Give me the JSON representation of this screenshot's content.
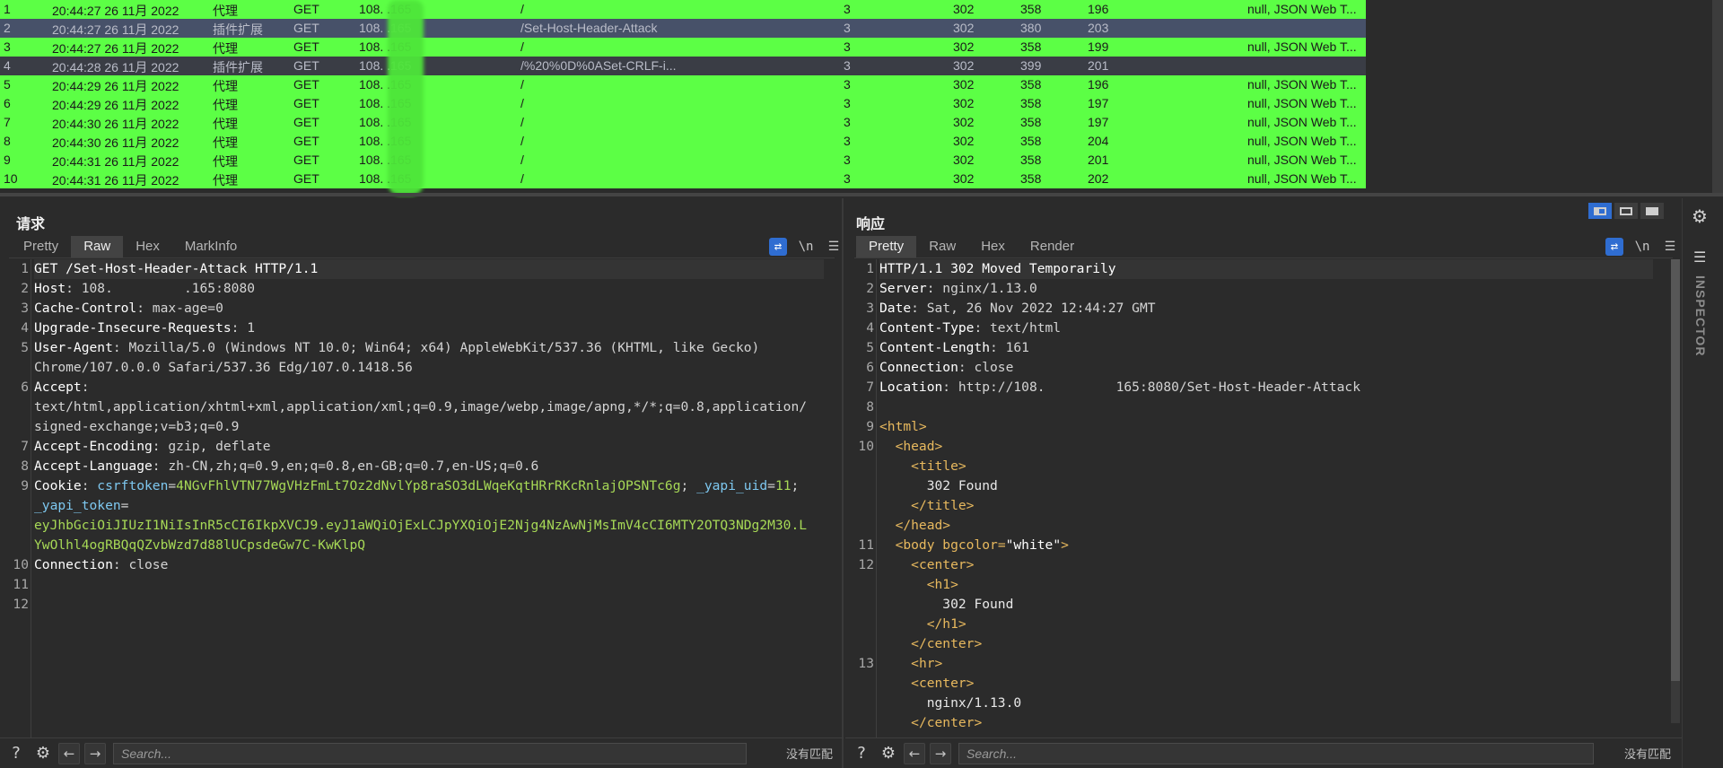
{
  "history": {
    "rows": [
      {
        "id": "1",
        "time": "20:44:27 26 11月 2022",
        "tool": "代理",
        "method": "GET",
        "host": "108.         .165",
        "path": "/",
        "edited": "3",
        "status": "302",
        "length": "358",
        "rtime": "196",
        "notes": "null, JSON Web T...",
        "style": "green"
      },
      {
        "id": "2",
        "time": "20:44:27 26 11月 2022",
        "tool": "插件扩展",
        "method": "GET",
        "host": "108.         .165",
        "path": "/Set-Host-Header-Attack",
        "edited": "3",
        "status": "302",
        "length": "380",
        "rtime": "203",
        "notes": "",
        "style": "sel"
      },
      {
        "id": "3",
        "time": "20:44:27 26 11月 2022",
        "tool": "代理",
        "method": "GET",
        "host": "108.         .165",
        "path": "/",
        "edited": "3",
        "status": "302",
        "length": "358",
        "rtime": "199",
        "notes": "null, JSON Web T...",
        "style": "green"
      },
      {
        "id": "4",
        "time": "20:44:28 26 11月 2022",
        "tool": "插件扩展",
        "method": "GET",
        "host": "108.         .165",
        "path": "/%20%0D%0ASet-CRLF-i...",
        "edited": "3",
        "status": "302",
        "length": "399",
        "rtime": "201",
        "notes": "",
        "style": "dark"
      },
      {
        "id": "5",
        "time": "20:44:29 26 11月 2022",
        "tool": "代理",
        "method": "GET",
        "host": "108.         .165",
        "path": "/",
        "edited": "3",
        "status": "302",
        "length": "358",
        "rtime": "196",
        "notes": "null, JSON Web T...",
        "style": "green"
      },
      {
        "id": "6",
        "time": "20:44:29 26 11月 2022",
        "tool": "代理",
        "method": "GET",
        "host": "108.         .165",
        "path": "/",
        "edited": "3",
        "status": "302",
        "length": "358",
        "rtime": "197",
        "notes": "null, JSON Web T...",
        "style": "green"
      },
      {
        "id": "7",
        "time": "20:44:30 26 11月 2022",
        "tool": "代理",
        "method": "GET",
        "host": "108.         .165",
        "path": "/",
        "edited": "3",
        "status": "302",
        "length": "358",
        "rtime": "197",
        "notes": "null, JSON Web T...",
        "style": "green"
      },
      {
        "id": "8",
        "time": "20:44:30 26 11月 2022",
        "tool": "代理",
        "method": "GET",
        "host": "108.         .165",
        "path": "/",
        "edited": "3",
        "status": "302",
        "length": "358",
        "rtime": "204",
        "notes": "null, JSON Web T...",
        "style": "green"
      },
      {
        "id": "9",
        "time": "20:44:31 26 11月 2022",
        "tool": "代理",
        "method": "GET",
        "host": "108.         .165",
        "path": "/",
        "edited": "3",
        "status": "302",
        "length": "358",
        "rtime": "201",
        "notes": "null, JSON Web T...",
        "style": "green"
      },
      {
        "id": "10",
        "time": "20:44:31 26 11月 2022",
        "tool": "代理",
        "method": "GET",
        "host": "108.         .165",
        "path": "/",
        "edited": "3",
        "status": "302",
        "length": "358",
        "rtime": "202",
        "notes": "null, JSON Web T...",
        "style": "green"
      }
    ]
  },
  "request": {
    "title": "请求",
    "tabs": [
      "Pretty",
      "Raw",
      "Hex",
      "MarkInfo"
    ],
    "active_tab": "Raw",
    "newline_label": "\\n",
    "menu_label": "☰",
    "wrap_label": "⇄",
    "lines": [
      {
        "n": "1",
        "parts": [
          {
            "c": "k",
            "t": "GET /Set-Host-Header-Attack HTTP/1.1"
          }
        ]
      },
      {
        "n": "2",
        "parts": [
          {
            "c": "k",
            "t": "Host"
          },
          {
            "c": "v",
            "t": ": 108."
          },
          {
            "c": "v",
            "t": "         "
          },
          {
            "c": "v",
            "t": ".165:8080"
          }
        ]
      },
      {
        "n": "3",
        "parts": [
          {
            "c": "k",
            "t": "Cache-Control"
          },
          {
            "c": "v",
            "t": ": max-age=0"
          }
        ]
      },
      {
        "n": "4",
        "parts": [
          {
            "c": "k",
            "t": "Upgrade-Insecure-Requests"
          },
          {
            "c": "v",
            "t": ": 1"
          }
        ]
      },
      {
        "n": "5",
        "parts": [
          {
            "c": "k",
            "t": "User-Agent"
          },
          {
            "c": "v",
            "t": ": Mozilla/5.0 (Windows NT 10.0; Win64; x64) AppleWebKit/537.36 (KHTML, like Gecko)"
          }
        ]
      },
      {
        "n": "",
        "parts": [
          {
            "c": "v",
            "t": "Chrome/107.0.0.0 Safari/537.36 Edg/107.0.1418.56"
          }
        ]
      },
      {
        "n": "6",
        "parts": [
          {
            "c": "k",
            "t": "Accept"
          },
          {
            "c": "v",
            "t": ":"
          }
        ]
      },
      {
        "n": "",
        "parts": [
          {
            "c": "v",
            "t": "text/html,application/xhtml+xml,application/xml;q=0.9,image/webp,image/apng,*/*;q=0.8,application/"
          }
        ]
      },
      {
        "n": "",
        "parts": [
          {
            "c": "v",
            "t": "signed-exchange;v=b3;q=0.9"
          }
        ]
      },
      {
        "n": "7",
        "parts": [
          {
            "c": "k",
            "t": "Accept-Encoding"
          },
          {
            "c": "v",
            "t": ": gzip, deflate"
          }
        ]
      },
      {
        "n": "8",
        "parts": [
          {
            "c": "k",
            "t": "Accept-Language"
          },
          {
            "c": "v",
            "t": ": zh-CN,zh;q=0.9,en;q=0.8,en-GB;q=0.7,en-US;q=0.6"
          }
        ]
      },
      {
        "n": "9",
        "parts": [
          {
            "c": "k",
            "t": "Cookie"
          },
          {
            "c": "v",
            "t": ": "
          },
          {
            "c": "ck",
            "t": "csrftoken"
          },
          {
            "c": "v",
            "t": "="
          },
          {
            "c": "cv",
            "t": "4NGvFhlVTN77WgVHzFmLt7Oz2dNvlYp8raSO3dLWqeKqtHRrRKcRnlajOPSNTc6g"
          },
          {
            "c": "v",
            "t": "; "
          },
          {
            "c": "ck",
            "t": "_yapi_uid"
          },
          {
            "c": "v",
            "t": "="
          },
          {
            "c": "cv",
            "t": "11"
          },
          {
            "c": "v",
            "t": ";"
          }
        ]
      },
      {
        "n": "",
        "parts": [
          {
            "c": "ck",
            "t": "_yapi_token"
          },
          {
            "c": "v",
            "t": "="
          }
        ]
      },
      {
        "n": "",
        "parts": [
          {
            "c": "cv",
            "t": "eyJhbGciOiJIUzI1NiIsInR5cCI6IkpXVCJ9.eyJ1aWQiOjExLCJpYXQiOjE2Njg4NzAwNjMsImV4cCI6MTY2OTQ3NDg2M30.L"
          }
        ]
      },
      {
        "n": "",
        "parts": [
          {
            "c": "cv",
            "t": "YwOlhl4ogRBQqQZvbWzd7d88lUCpsdeGw7C-KwKlpQ"
          }
        ]
      },
      {
        "n": "10",
        "parts": [
          {
            "c": "k",
            "t": "Connection"
          },
          {
            "c": "v",
            "t": ": close"
          }
        ]
      },
      {
        "n": "11",
        "parts": []
      },
      {
        "n": "12",
        "parts": []
      }
    ],
    "search_placeholder": "Search...",
    "match_text": "没有匹配"
  },
  "response": {
    "title": "响应",
    "tabs": [
      "Pretty",
      "Raw",
      "Hex",
      "Render"
    ],
    "active_tab": "Pretty",
    "newline_label": "\\n",
    "menu_label": "☰",
    "wrap_label": "⇄",
    "lines": [
      {
        "n": "1",
        "parts": [
          {
            "c": "k",
            "t": "HTTP/1.1 302 Moved Temporarily"
          }
        ]
      },
      {
        "n": "2",
        "parts": [
          {
            "c": "k",
            "t": "Server"
          },
          {
            "c": "v",
            "t": ": nginx/1.13.0"
          }
        ]
      },
      {
        "n": "3",
        "parts": [
          {
            "c": "k",
            "t": "Date"
          },
          {
            "c": "v",
            "t": ": Sat, 26 Nov 2022 12:44:27 GMT"
          }
        ]
      },
      {
        "n": "4",
        "parts": [
          {
            "c": "k",
            "t": "Content-Type"
          },
          {
            "c": "v",
            "t": ": text/html"
          }
        ]
      },
      {
        "n": "5",
        "parts": [
          {
            "c": "k",
            "t": "Content-Length"
          },
          {
            "c": "v",
            "t": ": 161"
          }
        ]
      },
      {
        "n": "6",
        "parts": [
          {
            "c": "k",
            "t": "Connection"
          },
          {
            "c": "v",
            "t": ": close"
          }
        ]
      },
      {
        "n": "7",
        "parts": [
          {
            "c": "k",
            "t": "Location"
          },
          {
            "c": "v",
            "t": ": http://108."
          },
          {
            "c": "v",
            "t": "         "
          },
          {
            "c": "v",
            "t": "165:8080/Set-Host-Header-Attack"
          }
        ]
      },
      {
        "n": "8",
        "parts": []
      },
      {
        "n": "9",
        "parts": [
          {
            "c": "tag",
            "t": "<html>"
          }
        ]
      },
      {
        "n": "10",
        "parts": [
          {
            "c": "v",
            "t": "  "
          },
          {
            "c": "tag",
            "t": "<head>"
          }
        ]
      },
      {
        "n": "",
        "parts": [
          {
            "c": "v",
            "t": "    "
          },
          {
            "c": "tag",
            "t": "<title>"
          }
        ]
      },
      {
        "n": "",
        "parts": [
          {
            "c": "v",
            "t": "      "
          },
          {
            "c": "txt",
            "t": "302 Found"
          }
        ]
      },
      {
        "n": "",
        "parts": [
          {
            "c": "v",
            "t": "    "
          },
          {
            "c": "tag",
            "t": "</title>"
          }
        ]
      },
      {
        "n": "",
        "parts": [
          {
            "c": "v",
            "t": "  "
          },
          {
            "c": "tag",
            "t": "</head>"
          }
        ]
      },
      {
        "n": "11",
        "parts": [
          {
            "c": "v",
            "t": "  "
          },
          {
            "c": "tag",
            "t": "<body "
          },
          {
            "c": "attr",
            "t": "bgcolor"
          },
          {
            "c": "tag",
            "t": "="
          },
          {
            "c": "astr",
            "t": "\"white\""
          },
          {
            "c": "tag",
            "t": ">"
          }
        ]
      },
      {
        "n": "12",
        "parts": [
          {
            "c": "v",
            "t": "    "
          },
          {
            "c": "tag",
            "t": "<center>"
          }
        ]
      },
      {
        "n": "",
        "parts": [
          {
            "c": "v",
            "t": "      "
          },
          {
            "c": "tag",
            "t": "<h1>"
          }
        ]
      },
      {
        "n": "",
        "parts": [
          {
            "c": "v",
            "t": "        "
          },
          {
            "c": "txt",
            "t": "302 Found"
          }
        ]
      },
      {
        "n": "",
        "parts": [
          {
            "c": "v",
            "t": "      "
          },
          {
            "c": "tag",
            "t": "</h1>"
          }
        ]
      },
      {
        "n": "",
        "parts": [
          {
            "c": "v",
            "t": "    "
          },
          {
            "c": "tag",
            "t": "</center>"
          }
        ]
      },
      {
        "n": "13",
        "parts": [
          {
            "c": "v",
            "t": "    "
          },
          {
            "c": "tag",
            "t": "<hr>"
          }
        ]
      },
      {
        "n": "",
        "parts": [
          {
            "c": "v",
            "t": "    "
          },
          {
            "c": "tag",
            "t": "<center>"
          }
        ]
      },
      {
        "n": "",
        "parts": [
          {
            "c": "v",
            "t": "      "
          },
          {
            "c": "txt",
            "t": "nginx/1.13.0"
          }
        ]
      },
      {
        "n": "",
        "parts": [
          {
            "c": "v",
            "t": "    "
          },
          {
            "c": "tag",
            "t": "</center>"
          }
        ]
      }
    ],
    "search_placeholder": "Search...",
    "match_text": "没有匹配"
  },
  "side": {
    "inspector_label": "INSPECTOR"
  },
  "colors": {
    "highlight_green": "#5cff45",
    "selected_row": "#475169",
    "accent_blue": "#2f6dd1"
  },
  "icons": {
    "help": "help-icon",
    "settings": "gear-icon",
    "back": "arrow-left-icon",
    "forward": "arrow-right-icon"
  }
}
